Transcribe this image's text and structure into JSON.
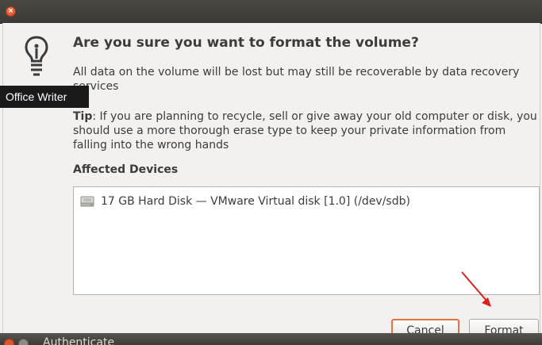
{
  "window": {
    "close_glyph": "×"
  },
  "dialog": {
    "icon": "lightbulb-icon",
    "heading": "Are you sure you want to format the volume?",
    "message": "All data on the volume will be lost but may still be recoverable by data recovery services",
    "tip_label": "Tip",
    "tip_text": ": If you are planning to recycle, sell or give away your old computer or disk, you should use a more thorough erase type to keep your private information from falling into the wrong hands",
    "affected_label": "Affected Devices",
    "devices": [
      {
        "icon": "hard-disk-icon",
        "label": "17 GB Hard Disk — VMware Virtual disk [1.0] (/dev/sdb)"
      }
    ],
    "cancel_label": "Cancel",
    "format_label": "Format"
  },
  "tooltip": {
    "text": "Office Writer"
  },
  "auth_window": {
    "title": "Authenticate"
  },
  "colors": {
    "titlebar": "#3c3b37",
    "close_button": "#e0542a",
    "focus_outline": "#e77241",
    "annotation_arrow": "#d9201a"
  }
}
